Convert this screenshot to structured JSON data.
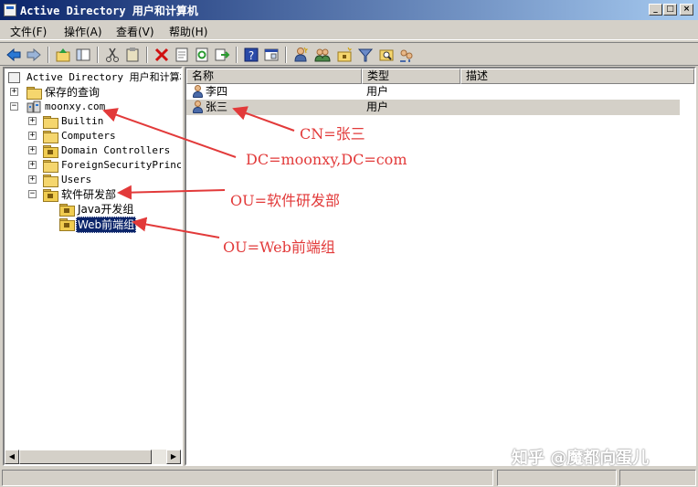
{
  "window": {
    "title": "Active Directory 用户和计算机",
    "minimize": "_",
    "maximize": "□",
    "close": "×"
  },
  "menu": [
    {
      "label": "文件(F)"
    },
    {
      "label": "操作(A)"
    },
    {
      "label": "查看(V)"
    },
    {
      "label": "帮助(H)"
    }
  ],
  "tree": {
    "root": "Active Directory 用户和计算机",
    "saved_queries": "保存的查询",
    "domain": "moonxy.com",
    "children": [
      "Builtin",
      "Computers",
      "Domain Controllers",
      "ForeignSecurityPrincip",
      "Users"
    ],
    "ou": "软件研发部",
    "ou_children": [
      "Java开发组",
      "Web前端组"
    ],
    "expand_plus": "+",
    "expand_minus": "−"
  },
  "list": {
    "columns": [
      "名称",
      "类型",
      "描述"
    ],
    "rows": [
      {
        "name": "李四",
        "type": "用户",
        "desc": ""
      },
      {
        "name": "张三",
        "type": "用户",
        "desc": ""
      }
    ]
  },
  "annotations": {
    "cn": "CN=张三",
    "dc": "DC=moonxy,DC=com",
    "ou": "OU=软件研发部",
    "ou2": "OU=Web前端组"
  },
  "watermark": "知乎 @魔都向蛋儿",
  "scroll": {
    "left": "◀",
    "right": "▶"
  },
  "colors": {
    "titlebar_start": "#0a246a",
    "titlebar_end": "#a6caf0",
    "annotation": "#e23a3a",
    "selection": "#0a246a"
  },
  "icons": [
    "back-icon",
    "forward-icon",
    "up-icon",
    "show-tree-icon",
    "cut-icon",
    "paste-icon",
    "delete-icon",
    "properties-icon",
    "refresh-icon",
    "export-icon",
    "help-icon",
    "console-icon",
    "new-user-icon",
    "new-group-icon",
    "new-ou-icon",
    "filter-icon",
    "find-icon",
    "add-to-group-icon"
  ]
}
